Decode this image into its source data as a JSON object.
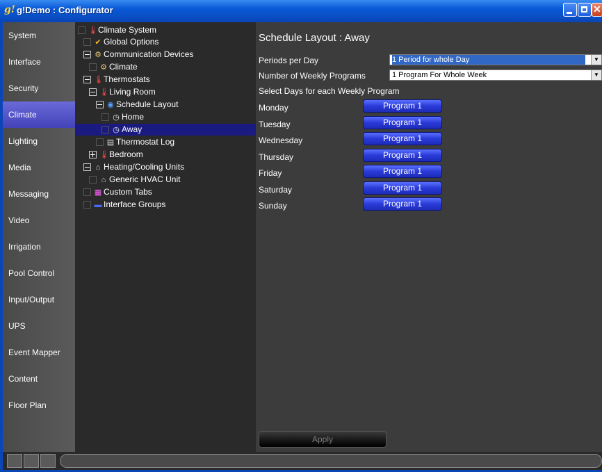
{
  "window": {
    "title": "g!Demo : Configurator",
    "app_icon": "g!"
  },
  "nav": {
    "items": [
      {
        "label": "System",
        "active": false
      },
      {
        "label": "Interface",
        "active": false
      },
      {
        "label": "Security",
        "active": false
      },
      {
        "label": "Climate",
        "active": true
      },
      {
        "label": "Lighting",
        "active": false
      },
      {
        "label": "Media",
        "active": false
      },
      {
        "label": "Messaging",
        "active": false
      },
      {
        "label": "Video",
        "active": false
      },
      {
        "label": "Irrigation",
        "active": false
      },
      {
        "label": "Pool Control",
        "active": false
      },
      {
        "label": "Input/Output",
        "active": false
      },
      {
        "label": "UPS",
        "active": false
      },
      {
        "label": "Event Mapper",
        "active": false
      },
      {
        "label": "Content",
        "active": false
      },
      {
        "label": "Floor Plan",
        "active": false
      }
    ]
  },
  "tree": {
    "nodes": [
      {
        "label": "Climate System",
        "icon": "thermometer-icon"
      },
      {
        "label": "Global Options",
        "icon": "options-icon"
      },
      {
        "label": "Communication Devices",
        "icon": "device-icon"
      },
      {
        "label": "Climate",
        "icon": "device-icon"
      },
      {
        "label": "Thermostats",
        "icon": "thermometer-icon"
      },
      {
        "label": "Living Room",
        "icon": "thermometer-icon"
      },
      {
        "label": "Schedule Layout",
        "icon": "globe-icon"
      },
      {
        "label": "Home",
        "icon": "clock-icon"
      },
      {
        "label": "Away",
        "icon": "clock-icon",
        "selected": true
      },
      {
        "label": "Thermostat Log",
        "icon": "log-icon"
      },
      {
        "label": "Bedroom",
        "icon": "thermometer-icon"
      },
      {
        "label": "Heating/Cooling Units",
        "icon": "hvac-icon"
      },
      {
        "label": "Generic HVAC Unit",
        "icon": "hvac-icon"
      },
      {
        "label": "Custom Tabs",
        "icon": "tabs-icon"
      },
      {
        "label": "Interface Groups",
        "icon": "groups-icon"
      }
    ]
  },
  "main": {
    "heading": "Schedule Layout : Away",
    "periods_label": "Periods per Day",
    "periods_value": "1 Period for whole Day",
    "programs_label": "Number of Weekly Programs",
    "programs_value": "1 Program For Whole Week",
    "select_days_label": "Select Days for each Weekly Program",
    "days": [
      {
        "day": "Monday",
        "program": "Program 1"
      },
      {
        "day": "Tuesday",
        "program": "Program 1"
      },
      {
        "day": "Wednesday",
        "program": "Program 1"
      },
      {
        "day": "Thursday",
        "program": "Program 1"
      },
      {
        "day": "Friday",
        "program": "Program 1"
      },
      {
        "day": "Saturday",
        "program": "Program 1"
      },
      {
        "day": "Sunday",
        "program": "Program 1"
      }
    ],
    "apply_label": "Apply"
  },
  "colors": {
    "titlebar": "#0a5ad8",
    "nav_active": "#5555c8",
    "tree_selected": "#1a1a80",
    "program_button": "#2a3ad8"
  }
}
